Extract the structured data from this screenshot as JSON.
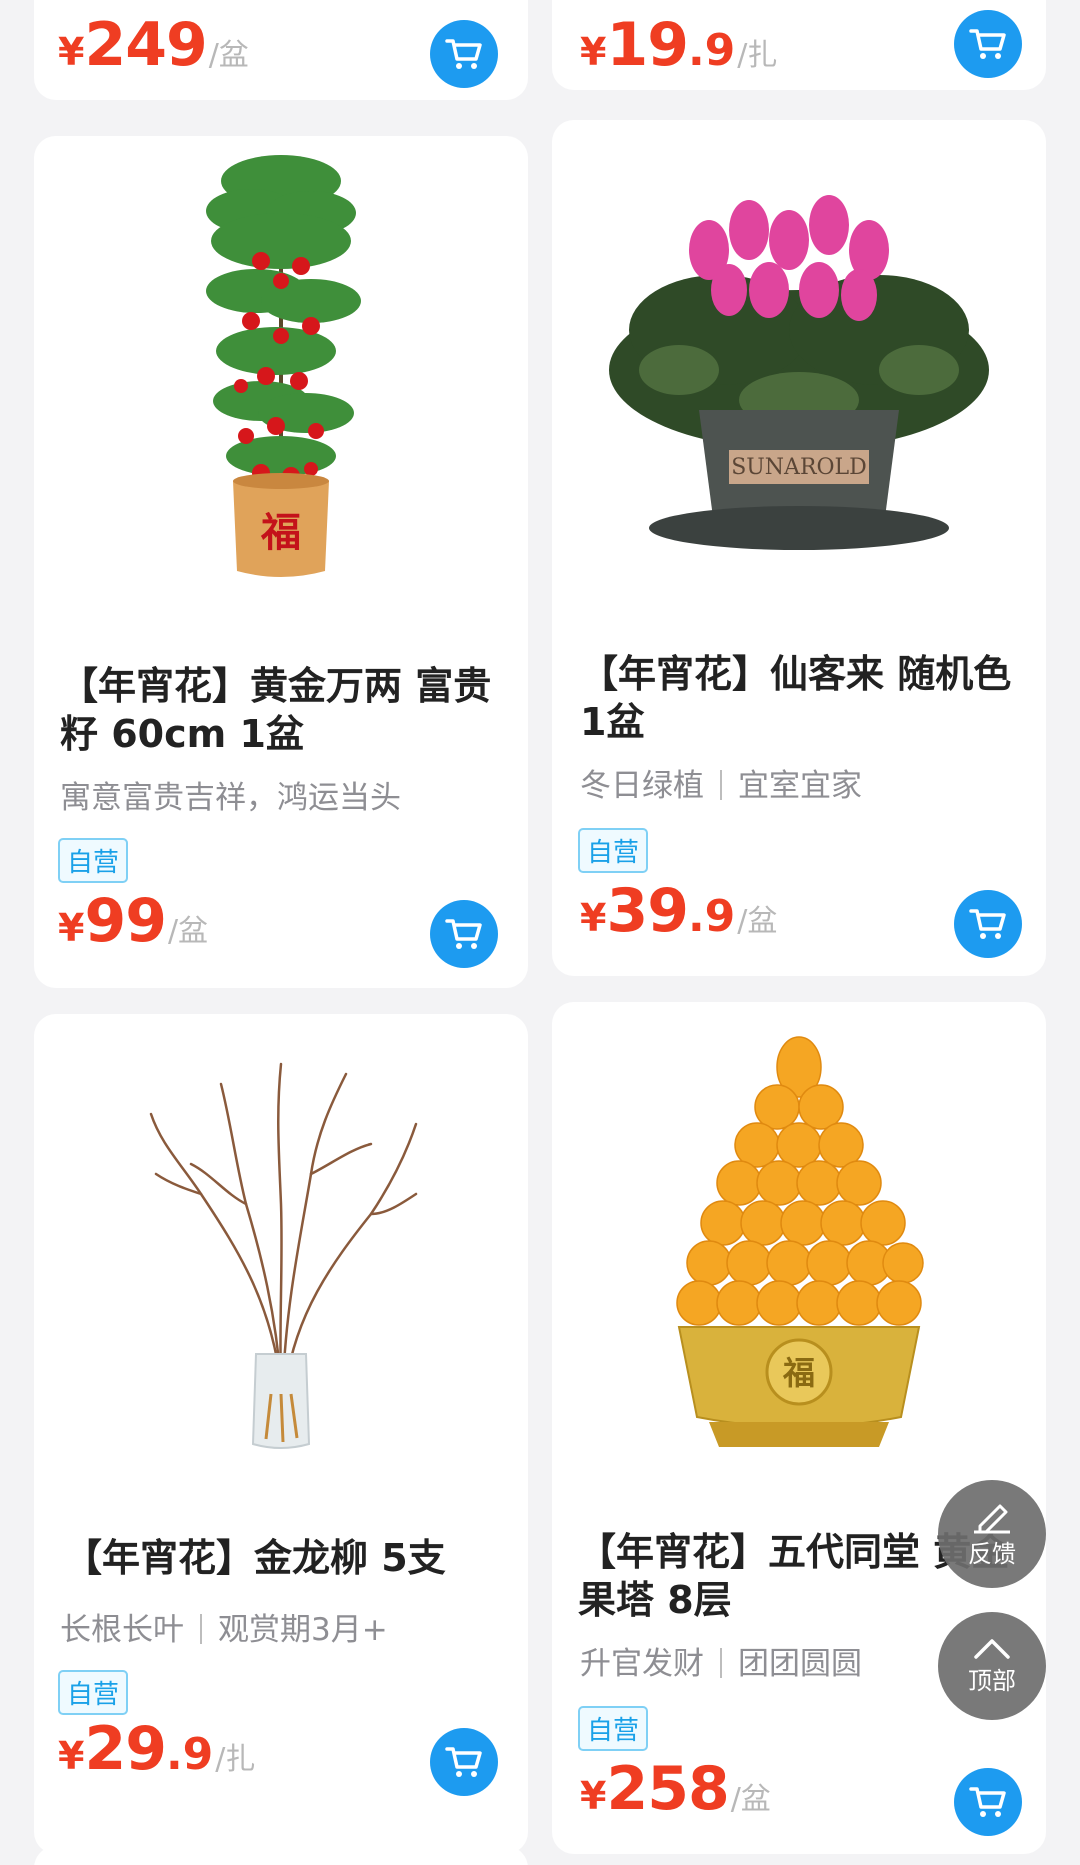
{
  "colors": {
    "price": "#ef3d22",
    "accent": "#1d9bf0",
    "tag_text": "#1aa1e8"
  },
  "top_row": [
    {
      "price_currency": "¥",
      "price_int": "249",
      "price_dec": "",
      "unit": "/盆",
      "cart_icon": "cart-icon"
    },
    {
      "price_currency": "¥",
      "price_int": "19",
      "price_dec": ".9",
      "unit": "/扎",
      "cart_icon": "cart-icon"
    }
  ],
  "products": [
    {
      "title": "【年宵花】黄金万两 富贵籽 60cm 1盆",
      "subtitle": [
        "寓意富贵吉祥，鸿运当头"
      ],
      "tag": "自营",
      "price_currency": "¥",
      "price_int": "99",
      "price_dec": "",
      "unit": "/盆",
      "image_icon": "potted-red-berry-plant"
    },
    {
      "title": "【年宵花】仙客来 随机色 1盆",
      "subtitle": [
        "冬日绿植",
        "宜室宜家"
      ],
      "tag": "自营",
      "price_currency": "¥",
      "price_int": "39",
      "price_dec": ".9",
      "unit": "/盆",
      "image_icon": "cyclamen-pot",
      "pot_text": "SUNAROLD"
    },
    {
      "title": "【年宵花】金龙柳 5支",
      "subtitle": [
        "长根长叶",
        "观赏期3月+"
      ],
      "tag": "自营",
      "price_currency": "¥",
      "price_int": "29",
      "price_dec": ".9",
      "unit": "/扎",
      "image_icon": "curly-willow-vase"
    },
    {
      "title": "【年宵花】五代同堂 黄金果塔 8层",
      "subtitle": [
        "升官发财",
        "团团圆圆"
      ],
      "tag": "自营",
      "price_currency": "¥",
      "price_int": "258",
      "price_dec": "",
      "unit": "/盆",
      "image_icon": "golden-fruit-tower"
    }
  ],
  "floating": {
    "feedback_label": "反馈",
    "top_label": "顶部"
  }
}
